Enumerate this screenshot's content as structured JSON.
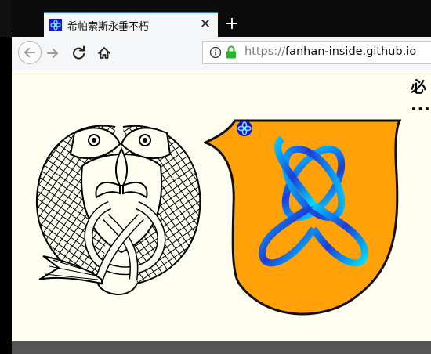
{
  "browser": {
    "tab": {
      "title": "希帕索斯永垂不朽",
      "close_glyph": "✕"
    },
    "new_tab_glyph": "+",
    "address_bar": {
      "scheme": "https://",
      "host": "fanhan-inside.github.io"
    },
    "colors": {
      "tab_accent": "#0a84ff",
      "lock": "#2ab52a",
      "favicon": "#1515d6"
    }
  },
  "page": {
    "heading_fragment": "必",
    "ellipsis": "....",
    "background": "#fefff1",
    "illustrations": [
      {
        "name": "fish-emblem-drawing",
        "style": "black line art"
      },
      {
        "name": "orange-flask-logo",
        "fill": "#ffa20a",
        "symbol": "four-loop knot"
      }
    ]
  }
}
